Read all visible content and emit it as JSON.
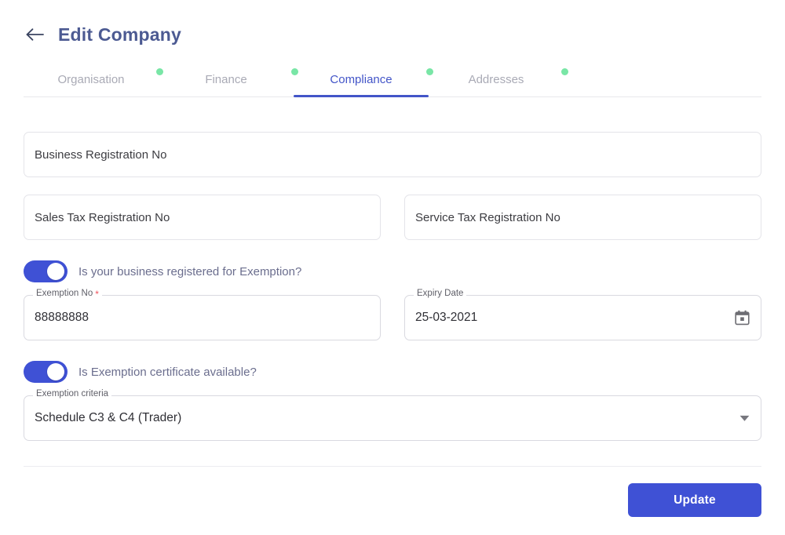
{
  "header": {
    "back_icon": "arrow-left-icon",
    "title": "Edit Company"
  },
  "tabs": {
    "active_index": 2,
    "items": [
      {
        "label": "Organisation",
        "has_badge": true,
        "active": false
      },
      {
        "label": "Finance",
        "has_badge": true,
        "active": false
      },
      {
        "label": "Compliance",
        "has_badge": true,
        "active": true
      },
      {
        "label": "Addresses",
        "has_badge": true,
        "active": false
      }
    ]
  },
  "form": {
    "business_registration": {
      "placeholder": "Business Registration No",
      "value": ""
    },
    "sales_tax": {
      "placeholder": "Sales Tax Registration No",
      "value": ""
    },
    "service_tax": {
      "placeholder": "Service Tax Registration No",
      "value": ""
    },
    "exemption_toggle": {
      "label": "Is your business registered for Exemption?",
      "state": "on"
    },
    "exemption_no": {
      "label": "Exemption No",
      "required_marker": "*",
      "value": "88888888"
    },
    "expiry_date": {
      "label": "Expiry Date",
      "value": "25-03-2021",
      "icon": "calendar-icon"
    },
    "certificate_toggle": {
      "label": "Is Exemption certificate available?",
      "state": "on"
    },
    "exemption_criteria": {
      "label": "Exemption criteria",
      "value": "Schedule C3 & C4 (Trader)",
      "icon": "chevron-down-icon"
    }
  },
  "footer": {
    "update_label": "Update"
  },
  "colors": {
    "primary": "#3f51d5",
    "tab_active": "#4355c8",
    "tab_inactive": "#a9aab5",
    "title": "#4c5a92",
    "badge_green": "#79e6a6",
    "required_red": "#f0525c",
    "toggle_label": "#6b6e8e"
  }
}
